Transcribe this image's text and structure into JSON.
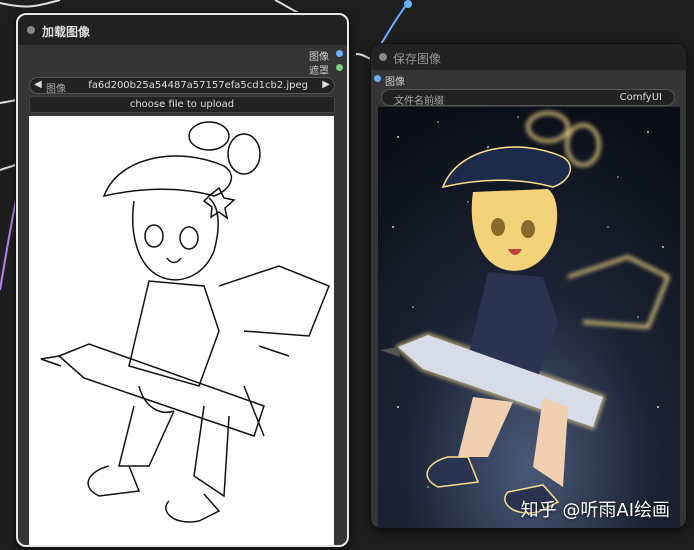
{
  "load_node": {
    "title": "加载图像",
    "outputs": [
      {
        "label": "图像",
        "color": "#6ab0ff"
      },
      {
        "label": "遮罩",
        "color": "#7ed07e"
      }
    ],
    "image_selector": {
      "label": "图像",
      "value": "fa6d200b25a54487a57157efa5cd1cb2.jpeg",
      "prev_icon": "◀",
      "next_icon": "▶"
    },
    "upload_button_label": "choose file to upload"
  },
  "save_node": {
    "title": "保存图像",
    "inputs": [
      {
        "label": "图像",
        "color": "#6ab0ff"
      }
    ],
    "filename_prefix": {
      "label": "文件名前缀",
      "value": "ComfyUI"
    }
  },
  "watermark": "知乎 @听雨AI绘画",
  "colors": {
    "canvas_bg": "#1e1e1e",
    "node_bg": "#353535",
    "title_bg": "#222222",
    "image_link": "#6ab0ff",
    "mask_link": "#7ed07e",
    "clip_link": "#c080f0"
  }
}
